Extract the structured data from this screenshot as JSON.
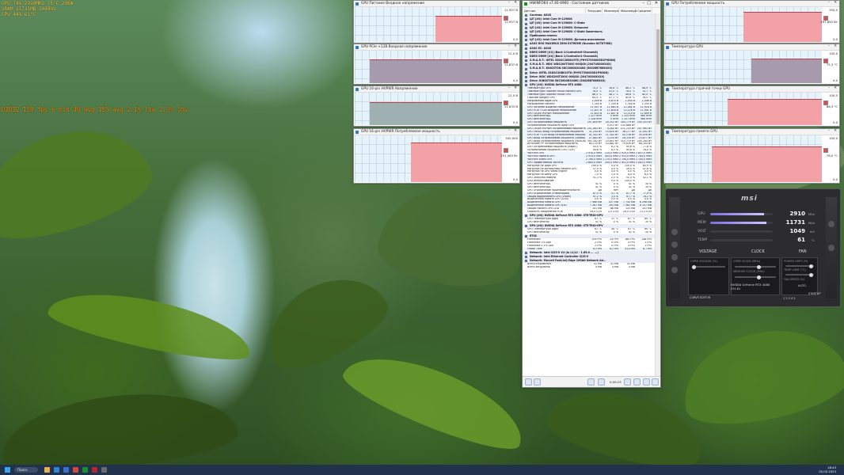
{
  "osd": {
    "top_lines": [
      "GPU   74%  2910MHz  75°C  296W",
      "VRAM  11731MB  1049mV",
      "CPU   44%  61°C"
    ],
    "fps_line": "D3D12  159 fps  6 min 40 avg  155 avg  2.1% low  1.5% low"
  },
  "graphs": [
    {
      "title": "GPU Питание Входное напряжение",
      "max": "11,957 В",
      "cur": "11,957 В",
      "min": "0,0",
      "color": "#f2a2a6",
      "level": 0.72,
      "step": 0.55
    },
    {
      "title": "GPU PCIe +12B Входное напряжение",
      "max": "12,0 В",
      "cur": "11,837 В",
      "min": "0,0",
      "color": "#a79aac",
      "level": 0.7,
      "step": 0.1
    },
    {
      "title": "GPU 16-pin HVPWR Напряжение",
      "max": "12,0 В",
      "cur": "11,833 В",
      "min": "0,0",
      "color": "#9fb0b0",
      "level": 0.68,
      "step": 0.1
    },
    {
      "title": "GPU 16-pin HVPWR Потребляемая мощность",
      "max": "300,000",
      "cur": "251,063 Вт",
      "min": "0,0",
      "color": "#f2a2a6",
      "level": 0.83,
      "step": 0.38
    },
    {
      "title": "GPU Потребляемая мощность",
      "max": "350,0",
      "cur": "297,850 Вт",
      "min": "0,0",
      "color": "#f2a2a6",
      "level": 0.85,
      "step": 0.5
    },
    {
      "title": "Температура GPU",
      "max": "100,0",
      "cur": "75,3 °C",
      "min": "0,0",
      "color": "#a79aac",
      "level": 0.72,
      "step": 0.55
    },
    {
      "title": "Температура горячей точки GPU",
      "max": "100,0",
      "cur": "86,3 °C",
      "min": "0,0",
      "color": "#f2a2a6",
      "level": 0.78,
      "step": 0.4
    },
    {
      "title": "Температура памяти GPU",
      "max": "100,0",
      "cur": "78,0 °C",
      "min": "0,0",
      "color": "#f2a2a6",
      "level": 0.75,
      "step": 0.3
    }
  ],
  "hwinfo": {
    "title": "HWiNFO64 v7.40-4960 - Состояние датчиков",
    "columns": [
      "Датчик",
      "Текущее",
      "Минимум",
      "Максимум",
      "Среднее"
    ],
    "rows": [
      {
        "t": "sec",
        "n": "Система: ASUS"
      },
      {
        "t": "sec",
        "n": "ЦП [#0]: Intel Core i9-12900K"
      },
      {
        "t": "sec",
        "n": "ЦП [#0]: Intel Core i9-12900K: C-State"
      },
      {
        "t": "sec",
        "n": "ЦП [#0]: Intel Core i9-12900K: Enhanced"
      },
      {
        "t": "sec",
        "n": "ЦП [#0]: Intel Core i9-12900K: C-State Заметность"
      },
      {
        "t": "sec",
        "n": "Приборная панель"
      },
      {
        "t": "sec",
        "n": "ЦП [#0]: Intel Core i9-12900K: Датчики исполнения"
      },
      {
        "t": "sec",
        "n": "ASUS ROG MAXIMUS Z690 EXTREME (Nuvoton NCT6798D)"
      },
      {
        "t": "sec",
        "n": "ASUS EC: ASUS"
      },
      {
        "t": "sec",
        "n": "DDR5 DIMM [#2] (Bank 1/Controller0-ChannelA)"
      },
      {
        "t": "sec",
        "n": "DDR5 DIMM [#4] (Bank 1/Controller1-ChannelA)"
      },
      {
        "t": "sec",
        "n": "S.M.A.R.T.: INTEL SSDSC2KB019T8 (PHYS7530005D1P9DGN)"
      },
      {
        "t": "sec",
        "n": "S.M.A.R.T.: WDC WDS200T3X0C-00SJG0 (2047US00XXXX)"
      },
      {
        "t": "sec",
        "n": "S.M.A.R.T.: KINGSTON SKC3000D2048G (50026B7686XXX)"
      },
      {
        "t": "sec",
        "n": "Drive: INTEL SSDSC2KB019T8 (PHYS7530005D1P9DGN)"
      },
      {
        "t": "sec",
        "n": "Drive: WDC WDS200T3X0C-00SJG0 (2047US00XXXX)"
      },
      {
        "t": "sec",
        "n": "Drive: KINGSTON SKC3000D2048G (50026B7686XXX)"
      },
      {
        "t": "sec",
        "n": "GPU [#0]: NVIDIA GeForce RTX 4080:"
      },
      {
        "n": "Температура GPU",
        "c": "75,3 °C",
        "mi": "38,8 °C",
        "ma": "86,2 °C",
        "av": "68,9 °C",
        "hl": true
      },
      {
        "n": "Температура горячей точки памяти GPU",
        "c": "78,0 °C",
        "mi": "41,0 °C",
        "ma": "78,0 °C",
        "av": "70,7 °C",
        "hl": true
      },
      {
        "n": "Температура горячей точки GPU",
        "c": "86,3 °C",
        "mi": "48,1 °C",
        "ma": "86,8 °C",
        "av": "80,4 °C",
        "hl": true
      },
      {
        "n": "Горячий предел GPU",
        "c": "85,5 °C",
        "mi": "47,1 °C",
        "ma": "85,6 °C",
        "av": "76,5 °C"
      },
      {
        "n": "Напряжение ядра GPU",
        "c": "1,049 В",
        "mi": "0,870 В",
        "ma": "1,050 В",
        "av": "1,046 В",
        "hl": true
      },
      {
        "n": "Напряжение памяти",
        "c": "1,350 В",
        "mi": "1,350 В",
        "ma": "1,350 В",
        "av": "1,350 В"
      },
      {
        "n": "GPU Питание Входное напряжение",
        "c": "11,957 В",
        "mi": "11,863 В",
        "ma": "12,082 В",
        "av": "11,918 В",
        "hl": true
      },
      {
        "n": "GPU PCIe +12B Входное напряжение",
        "c": "11,837 В",
        "mi": "11,818 В",
        "ma": "12,126 В",
        "av": "11,901 В",
        "hl": true
      },
      {
        "n": "GPU 16-pin HVPWR Напряжение",
        "c": "11,833 В",
        "mi": "11,807 В",
        "ma": "12,119 В",
        "av": "11,899 В",
        "hl": true
      },
      {
        "n": "GPU Вентилятор1",
        "c": "1 327 RPM",
        "mi": "0 RPM",
        "ma": "1 335 RPM",
        "av": "965 RPM",
        "hl": true
      },
      {
        "n": "GPU Вентилятор2",
        "c": "1 328 RPM",
        "mi": "0 RPM",
        "ma": "1 337 RPM",
        "av": "966 RPM",
        "hl": true
      },
      {
        "n": "GPU Потребляемая мощность",
        "c": "297,850 Вт",
        "mi": "20,352 Вт",
        "ma": "305,779 Вт",
        "av": "245,353 Вт",
        "hl": true
      },
      {
        "n": "Потребляемая мощность ядер GPU",
        "c": "",
        "mi": "0,012 Вт",
        "ma": "102,888 Вт",
        "av": ""
      },
      {
        "n": "GPU 16-pin HVPWR Потребляемая мощность",
        "c": "251,063 Вт",
        "mi": "9,262 Вт",
        "ma": "271,723 Вт",
        "av": "207,963 Вт",
        "hl": true
      },
      {
        "n": "GPU FBVDD Вход Потребляемая мощность",
        "c": "31,244 Вт",
        "mi": "15,620 Вт",
        "ma": "36,177 Вт",
        "av": "31,002 Вт",
        "hl": true
      },
      {
        "n": "GPU PCIe +12B Вход Потребляемая мощность",
        "c": "41,302 Вт",
        "mi": "11,302 Вт",
        "ma": "42,138 Вт",
        "av": "35,026 Вт",
        "hl": true
      },
      {
        "n": "GPU Вход Потребляемая мощность (сумма)",
        "c": "27,883 Вт",
        "mi": "5,335 Вт",
        "ma": "28,334 Вт",
        "av": "23,877 Вт",
        "hl": true
      },
      {
        "n": "GPU Вход Потребляемая мощность (NVVDD)",
        "c": "301,162 Вт",
        "mi": "23,802 Вт",
        "ma": "314,719 Вт",
        "av": "245,284 Вт"
      },
      {
        "n": "Источник PP Потребляемая мощность",
        "c": "84,133 Вт",
        "mi": "10,882 Вт",
        "ma": "79,830 Вт",
        "av": "68,344 Вт"
      },
      {
        "n": "GPU Потребляемая мощность (норм.)",
        "c": "93,5 %",
        "mi": "6,2 %",
        "ma": "95,6 %",
        "av": "77,8 %"
      },
      {
        "n": "Потребляемая мощность GPU (TDP)",
        "c": "94,6 %",
        "mi": "6,3 %",
        "ma": "95,6 %",
        "av": "76,0 %"
      },
      {
        "n": "Частота GPU",
        "c": "2 910,0 MHz",
        "mi": "210,0 MHz",
        "ma": "2 925,0 MHz",
        "av": "2 857,0 MHz",
        "hl": true
      },
      {
        "n": "Частота памяти GPU",
        "c": "2 933,0 MHz",
        "mi": "405,0 MHz",
        "ma": "2 933,0 MHz",
        "av": "2 784,0 MHz",
        "hl": true
      },
      {
        "n": "Частота Video GPU",
        "c": "2 190,0 MHz",
        "mi": "1 170,0 MHz",
        "ma": "2 190,0 MHz",
        "av": "2 140,0 MHz",
        "hl": true
      },
      {
        "n": "GPU Эффективная частота",
        "c": "2 883,0 MHz",
        "mi": "209,0 MHz",
        "ma": "2 901,0 MHz",
        "av": "2 082,0 MHz",
        "hl": true
      },
      {
        "n": "Нагрузка на ядро GPU",
        "c": "100,0 %",
        "mi": "0,0 %",
        "ma": "100,0 %",
        "av": "85,9 %"
      },
      {
        "n": "Нагрузка на контроллер памяти GPU",
        "c": "57,0 %",
        "mi": "0,0 %",
        "ma": "59,0 %",
        "av": "47,6 %"
      },
      {
        "n": "Нагрузка на GPU Video Engine",
        "c": "0,0 %",
        "mi": "0,0 %",
        "ma": "0,0 %",
        "av": "0,0 %"
      },
      {
        "n": "Нагрузка на шину GPU",
        "c": "7,0 %",
        "mi": "1,0 %",
        "ma": "8,0 %",
        "av": "6,0 %"
      },
      {
        "n": "GPU Загрузка памяти",
        "c": "51,3 %",
        "mi": "2,5 %",
        "ma": "51,5 %",
        "av": "42,1 %"
      },
      {
        "n": "D3D Использование",
        "c": "",
        "mi": "0,0 %",
        "ma": "100,0 %",
        "av": ""
      },
      {
        "n": "GPU Вентилятор1",
        "c": "41 %",
        "mi": "0 %",
        "ma": "41 %",
        "av": "30 %"
      },
      {
        "n": "GPU Вентилятор2",
        "c": "41 %",
        "mi": "0 %",
        "ma": "41 %",
        "av": "30 %"
      },
      {
        "n": "GPU Ограничение производительности",
        "c": "Да",
        "mi": "Нет",
        "ma": "Да",
        "av": "Да"
      },
      {
        "n": "GPU Ограничение (Утилизация)",
        "c": "87,0 %",
        "mi": "4,1 %",
        "ma": "87,7 %",
        "av": "77,9 %",
        "hl": true
      },
      {
        "n": "Общая видеопамять GPU (VRAM)",
        "c": "97,2 %",
        "mi": "3,4 %",
        "ma": "97,7 %",
        "av": "76,2 %",
        "hl": true
      },
      {
        "n": "Выделенная память GPU (D3D)",
        "c": "0,0 %",
        "mi": "0,0 %",
        "ma": "0,0 %",
        "av": "0,0 %"
      },
      {
        "n": "Выделенная память GPU",
        "c": "7 468 MB",
        "mi": "437 MB",
        "ma": "7 750 MB",
        "av": "6 298 MB",
        "hl": true
      },
      {
        "n": "Выделенная память GPU D3D",
        "c": "7 267 MB",
        "mi": "291 MB",
        "ma": "7 562 MB",
        "av": "6 157 MB",
        "hl": true
      },
      {
        "n": "Общая память GPU D3D",
        "c": "101 MB",
        "mi": "88 MB",
        "ma": "125 MB",
        "av": "101 MB"
      },
      {
        "n": "Скорость соединения PCIe",
        "c": "16,0 GT/s",
        "mi": "2,5 GT/s",
        "ma": "16,0 GT/s",
        "av": "13,3 GT/s"
      },
      {
        "t": "sec",
        "n": "GPU [#0]: NVIDIA GeForce RTX 4080: STE-TRIO-OPV"
      },
      {
        "n": "GPU Температура ядра",
        "c": "67 °C",
        "mi": "37 °C",
        "ma": "67 °C",
        "av": "60 °C"
      },
      {
        "n": "GPU Вентилятор",
        "c": "41 %",
        "mi": "0 %",
        "ma": "41 %",
        "av": "30 %"
      },
      {
        "t": "sec",
        "n": "GPU [#0]: NVIDIA GeForce RTX 4080: STE-TRIO-OPV"
      },
      {
        "n": "GPU Температура ядра",
        "c": "67 °C",
        "mi": "40 °C",
        "ma": "67 °C",
        "av": "60 °C"
      },
      {
        "n": "GPU Вентилятор",
        "c": "41 %",
        "mi": "0 %",
        "ma": "41 %",
        "av": "30 %"
      },
      {
        "t": "sec",
        "n": "RTSS"
      },
      {
        "n": "Framerate",
        "c": "159 FPS",
        "mi": "24 FPS",
        "ma": "160 FPS",
        "av": "148 FPS"
      },
      {
        "n": "Framerate 1% Low",
        "c": "2 FPS",
        "mi": "0 FPS",
        "ma": "4 FPS",
        "av": "1 FPS"
      },
      {
        "n": "Framerate 0.1% Low",
        "c": "2 FPS",
        "mi": "0 FPS",
        "ma": "3 FPS",
        "av": "1 FPS"
      },
      {
        "n": "Frame Time",
        "c": "6,3 ms",
        "mi": "6,2 ms",
        "ma": "41,4 ms",
        "av": "6,7 ms",
        "hl": true
      },
      {
        "t": "sec",
        "n": "Network: Intel I225-V #2 (in L1/L1 - 1.65.0 ... ...)"
      },
      {
        "t": "sec",
        "n": "Network: Intel Ethernet Controller I225-V"
      },
      {
        "t": "sec",
        "n": "Network: Marvell FastLinQ Edge 10Gbit Network Ad..."
      },
      {
        "n": "Всего отправлено",
        "c": "41 MB",
        "mi": "41 MB",
        "ma": "41 MB",
        "av": ""
      },
      {
        "n": "Всего загружено",
        "c": "4 MB",
        "mi": "4 MB",
        "ma": "4 MB",
        "av": ""
      }
    ],
    "status_time": "0:00:23"
  },
  "msi": {
    "logo": "msi",
    "rows": [
      {
        "label": "GPU",
        "value": "2910",
        "unit": "MHz",
        "level": 0.86
      },
      {
        "label": "MEM",
        "value": "11731",
        "unit": "MHz",
        "level": 0.9
      },
      {
        "label": "VOLT",
        "value": "1049",
        "unit": "mV",
        "level": 0.0
      },
      {
        "label": "TEMP",
        "value": "61",
        "unit": "°C",
        "level": 0.0
      }
    ],
    "tabs": [
      "VOLTAGE",
      "CLOCK",
      "FAN"
    ],
    "panel_labels": [
      "CORE VOLTAGE (%)",
      "CORE CLOCK (MHz)",
      "MEMORY CLOCK (MHz)",
      "POWER LIMIT (%)",
      "TEMP LIMIT (°C)",
      "FAN SPEED (%)"
    ],
    "gpu_name": "NVIDIA GeForce RTX 4080",
    "driver": "531.61",
    "startup": "STARTUP",
    "profile": "1 2 3 4 5",
    "curve_editor": "CURVE EDITOR",
    "fan_value": "AUTO"
  },
  "taskbar": {
    "search": "Поиск",
    "time": "18:43",
    "date": "05.05.2023"
  }
}
